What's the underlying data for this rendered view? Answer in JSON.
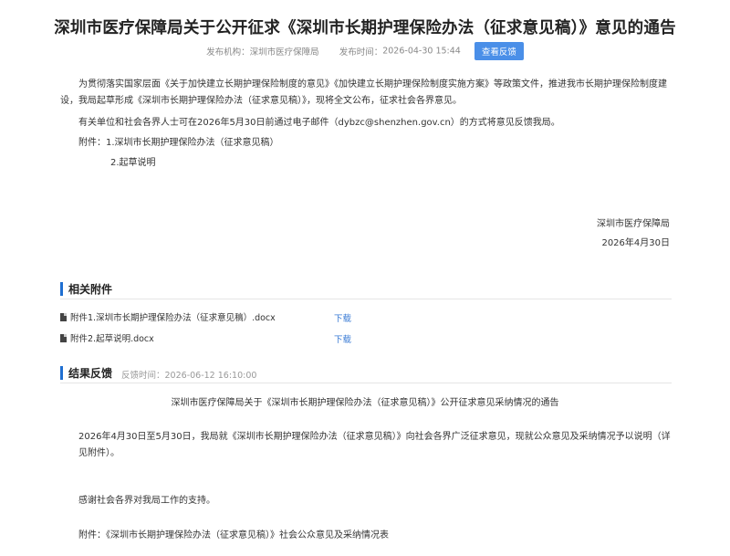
{
  "article": {
    "title": "深圳市医疗保障局关于公开征求《深圳市长期护理保险办法（征求意见稿）》意见的通告",
    "publisher_label": "发布机构：",
    "publisher": "深圳市医疗保障局",
    "time_label": "发布时间：",
    "time": "2026-04-30 15:44",
    "feedback_button": "查看反馈",
    "paragraph1": "为贯彻落实国家层面《关于加快建立长期护理保险制度的意见》《加快建立长期护理保险制度实施方案》等政策文件，推进我市长期护理保险制度建设，我局起草形成《深圳市长期护理保险办法（征求意见稿）》，现将全文公布，征求社会各界意见。",
    "paragraph2": "有关单位和社会各界人士可在2026年5月30日前通过电子邮件（dybzc@shenzhen.gov.cn）的方式将意见反馈我局。",
    "attachments_line1": "附件：1.深圳市长期护理保险办法（征求意见稿）",
    "attachments_line2": "2.起草说明",
    "signature_org": "深圳市医疗保障局",
    "signature_date": "2026年4月30日"
  },
  "related_attachments": {
    "heading": "相关附件",
    "files": [
      {
        "name": "附件1.深圳市长期护理保险办法（征求意见稿）.docx",
        "action": "下载"
      },
      {
        "name": "附件2.起草说明.docx",
        "action": "下载"
      }
    ]
  },
  "results": {
    "heading": "结果反馈",
    "time_label": "反馈时间：",
    "time": "2026-06-12 16:10:00",
    "notice_title": "深圳市医疗保障局关于《深圳市长期护理保险办法（征求意见稿）》公开征求意见采纳情况的通告",
    "paragraph1": "2026年4月30日至5月30日，我局就《深圳市长期护理保险办法（征求意见稿）》向社会各界广泛征求意见，现就公众意见及采纳情况予以说明（详见附件）。",
    "paragraph2": "感谢社会各界对我局工作的支持。",
    "attachment": "附件：《深圳市长期护理保险办法（征求意见稿）》社会公众意见及采纳情况表"
  }
}
